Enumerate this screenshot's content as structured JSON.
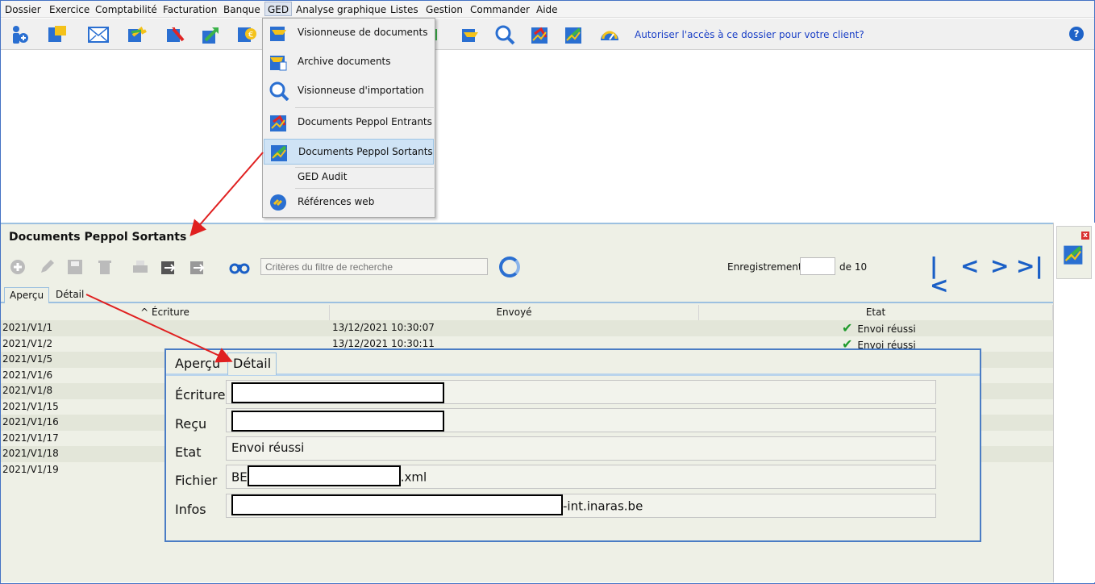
{
  "menubar": {
    "items": [
      "Dossier",
      "Exercice",
      "Comptabilité",
      "Facturation",
      "Banque",
      "GED",
      "Analyse graphique",
      "Listes",
      "Gestion",
      "Commander",
      "Aide"
    ]
  },
  "toolbar": {
    "icons": [
      "add-dossier-icon",
      "dossier-icon",
      "mail-icon",
      "transfer-icon",
      "import-icon",
      "export-icon",
      "money-icon",
      "ged-icon",
      "ged-viewer-icon",
      "search-import-icon",
      "peppol-in-icon",
      "peppol-out-icon",
      "speedometer-icon"
    ],
    "auth_link": "Autoriser l'accès à ce dossier pour votre client?",
    "help": "?"
  },
  "ged_menu": {
    "items": [
      {
        "label": "Visionneuse de documents",
        "icon": "document-viewer-icon"
      },
      {
        "label": "Archive documents",
        "icon": "archive-icon"
      },
      {
        "label": "Visionneuse d'importation",
        "icon": "import-viewer-icon"
      },
      {
        "label": "Documents Peppol Entrants",
        "icon": "peppol-incoming-icon"
      },
      {
        "label": "Documents Peppol Sortants",
        "icon": "peppol-outgoing-icon"
      },
      {
        "label": "GED Audit",
        "icon": ""
      },
      {
        "label": "Références web",
        "icon": "web-link-icon"
      }
    ],
    "selected": "Documents Peppol Sortants"
  },
  "panel": {
    "title": "Documents Peppol Sortants",
    "filter_placeholder": "Critères du filtre de recherche",
    "record_label": "Enregistrement",
    "record_of": "de 10",
    "tabs": [
      "Aperçu",
      "Détail"
    ],
    "columns": [
      "Écriture",
      "Envoyé",
      "Etat"
    ],
    "rows": [
      {
        "ecriture": "2021/V1/1",
        "envoye": "13/12/2021 10:30:07",
        "etat": "Envoi réussi"
      },
      {
        "ecriture": "2021/V1/2",
        "envoye": "13/12/2021 10:30:11",
        "etat": "Envoi réussi"
      },
      {
        "ecriture": "2021/V1/5",
        "envoye": "",
        "etat": ""
      },
      {
        "ecriture": "2021/V1/6",
        "envoye": "",
        "etat": ""
      },
      {
        "ecriture": "2021/V1/8",
        "envoye": "",
        "etat": ""
      },
      {
        "ecriture": "2021/V1/15",
        "envoye": "",
        "etat": ""
      },
      {
        "ecriture": "2021/V1/16",
        "envoye": "",
        "etat": ""
      },
      {
        "ecriture": "2021/V1/17",
        "envoye": "",
        "etat": ""
      },
      {
        "ecriture": "2021/V1/18",
        "envoye": "",
        "etat": ""
      },
      {
        "ecriture": "2021/V1/19",
        "envoye": "",
        "etat": ""
      }
    ]
  },
  "detail": {
    "tabs": [
      "Aperçu",
      "Détail"
    ],
    "fields": [
      {
        "label": "Écriture",
        "value": ""
      },
      {
        "label": "Reçu",
        "value": ""
      },
      {
        "label": "Etat",
        "value": "Envoi réussi"
      },
      {
        "label": "Fichier",
        "prefix": "BE",
        "suffix": ".xml"
      },
      {
        "label": "Infos",
        "prefix": "",
        "suffix": "-int.inaras.be"
      }
    ]
  },
  "colors": {
    "accent": "#1a5fc6",
    "success": "#1f9a2c",
    "annotation": "#e02020"
  }
}
